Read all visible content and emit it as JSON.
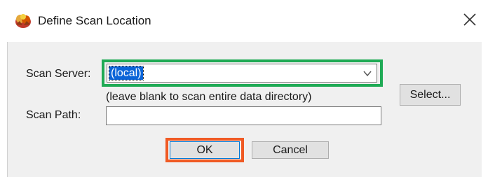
{
  "window": {
    "title": "Define Scan Location",
    "icon": "app-scan-icon",
    "close_glyph": "✕"
  },
  "form": {
    "scan_server_label": "Scan Server:",
    "scan_server_value": "(local)",
    "scan_server_hint": "(leave blank to scan entire data directory)",
    "select_button_label": "Select...",
    "scan_path_label": "Scan Path:",
    "scan_path_value": ""
  },
  "buttons": {
    "ok_label": "OK",
    "cancel_label": "Cancel"
  },
  "annotations": {
    "server_highlight_color": "#1faa55",
    "ok_highlight_color": "#f05a24"
  }
}
